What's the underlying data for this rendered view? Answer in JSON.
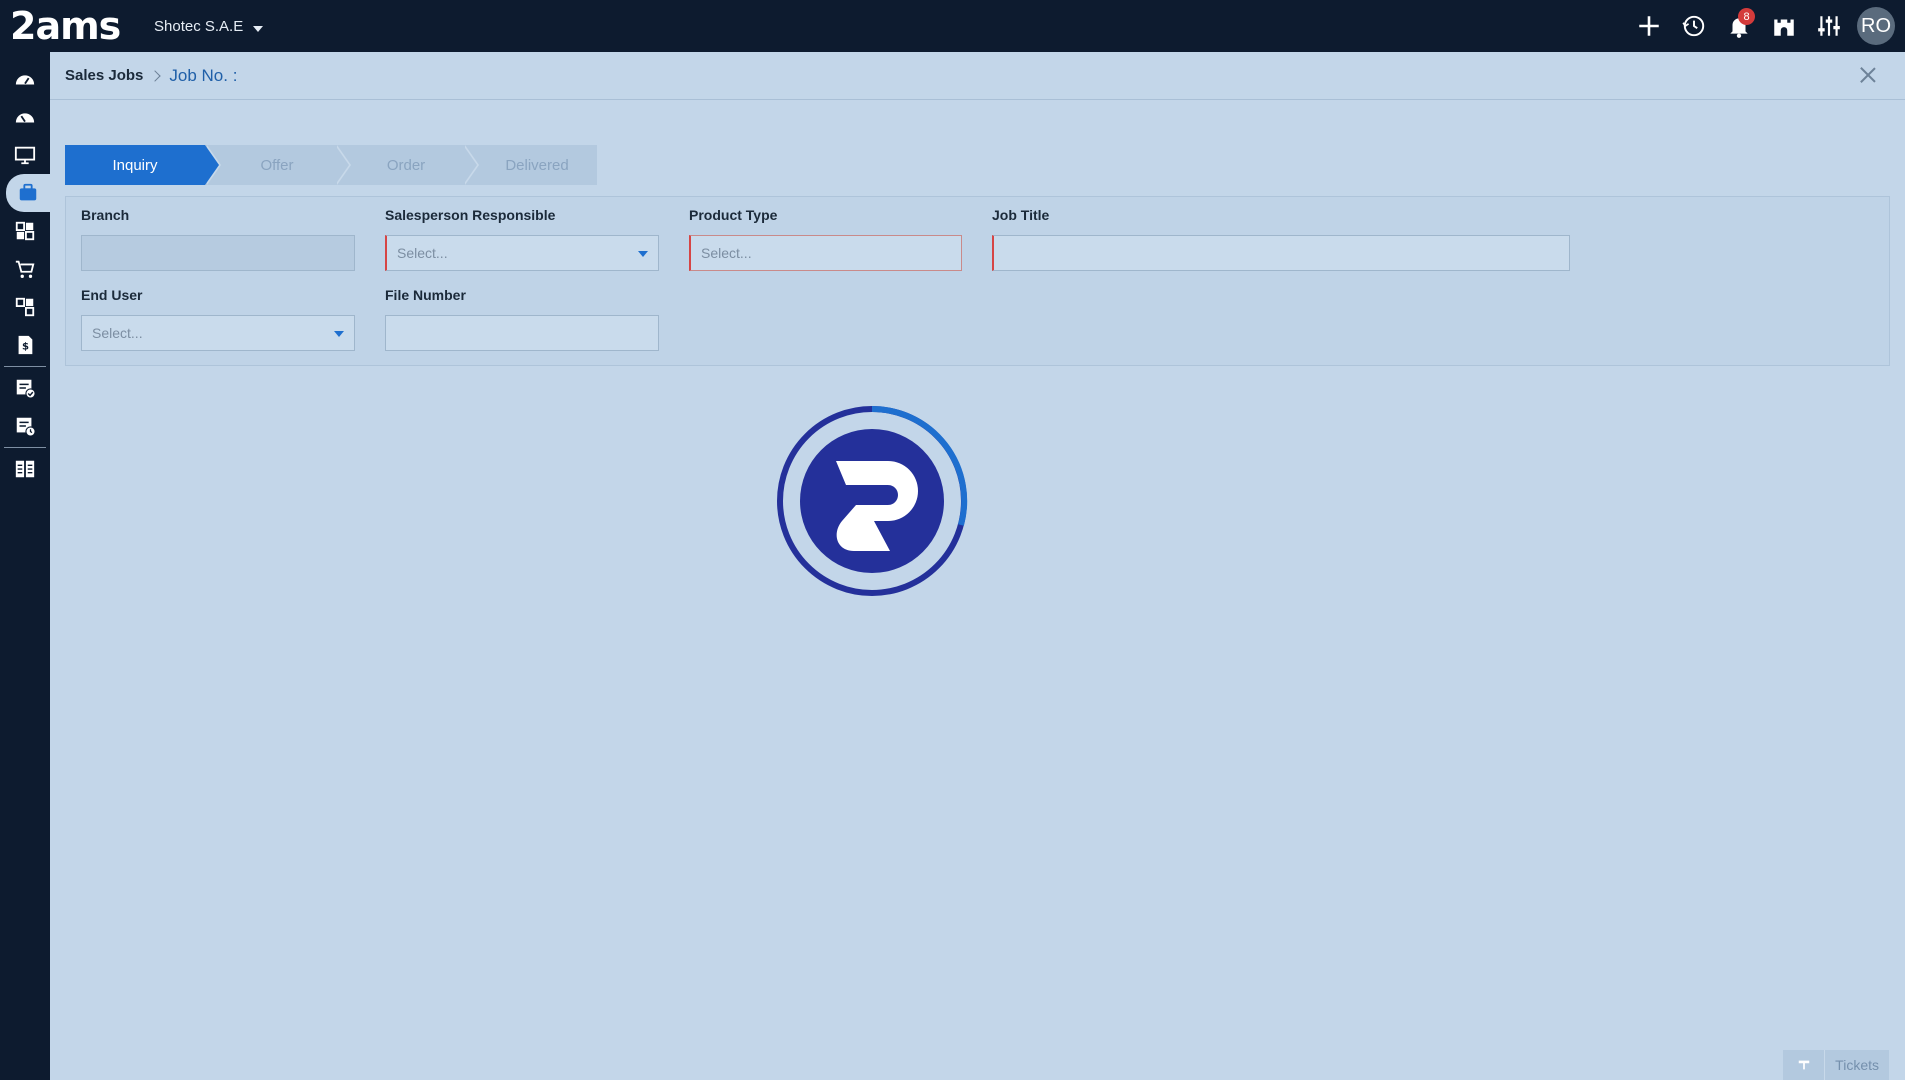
{
  "app": {
    "logo_text": "2ams",
    "company": "Shotec S.A.E",
    "notifications_count": "8",
    "avatar_initials": "RO"
  },
  "top_icons": [
    "add-icon",
    "history-icon",
    "bell-icon",
    "castle-icon",
    "sliders-icon"
  ],
  "sidebar": {
    "items": [
      "dashboard-icon",
      "dashboard-alt-icon",
      "monitor-icon",
      "briefcase-icon",
      "modules-icon",
      "cart-icon",
      "modules-alt-icon",
      "invoice-icon",
      "checklist-icon",
      "report-icon",
      "grid-icon"
    ],
    "active_index": 3
  },
  "breadcrumb": {
    "root": "Sales Jobs",
    "current": "Job No. :"
  },
  "stepper": {
    "steps": [
      "Inquiry",
      "Offer",
      "Order",
      "Delivered"
    ],
    "active": "Inquiry"
  },
  "form": {
    "branch": {
      "label": "Branch",
      "value": ""
    },
    "salesperson": {
      "label": "Salesperson Responsible",
      "placeholder": "Select..."
    },
    "product_type": {
      "label": "Product Type",
      "placeholder": "Select..."
    },
    "job_title": {
      "label": "Job Title",
      "value": ""
    },
    "end_user": {
      "label": "End User",
      "placeholder": "Select..."
    },
    "file_number": {
      "label": "File Number",
      "value": ""
    }
  },
  "footer": {
    "tickets_label": "Tickets"
  },
  "colors": {
    "topbar": "#0d1b2f",
    "background": "#c3d6e9",
    "accent": "#1e6fcf",
    "required": "#d64545",
    "loader": "#24309a"
  }
}
